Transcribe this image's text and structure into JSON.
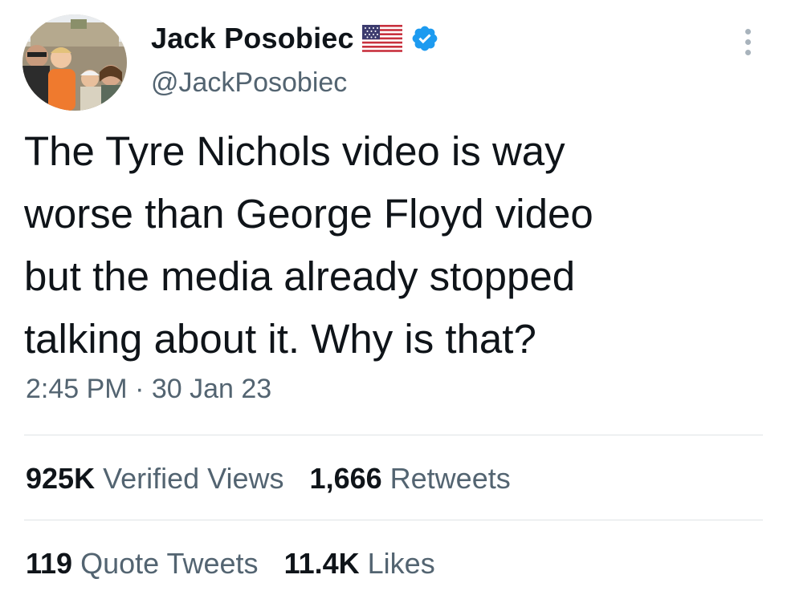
{
  "tweet": {
    "display_name": "Jack Posobiec",
    "handle": "@JackPosobiec",
    "text_lines": [
      "The Tyre Nichols video is way",
      "worse than George Floyd video",
      "but the media already stopped",
      "talking about it. Why is that?"
    ],
    "time": "2:45 PM",
    "separator": "·",
    "date": "30 Jan 23",
    "icons": {
      "flag": "us-flag-icon",
      "verified": "verified-badge-icon",
      "more": "more-options-icon"
    },
    "colors": {
      "verified": "#1d9bf0",
      "secondary_text": "#536471",
      "primary_text": "#0f1419"
    }
  },
  "stats": {
    "views": {
      "num": "925K",
      "label": "Verified Views"
    },
    "retweets": {
      "num": "1,666",
      "label": "Retweets"
    },
    "quotes": {
      "num": "119",
      "label": "Quote Tweets"
    },
    "likes": {
      "num": "11.4K",
      "label": "Likes"
    }
  }
}
